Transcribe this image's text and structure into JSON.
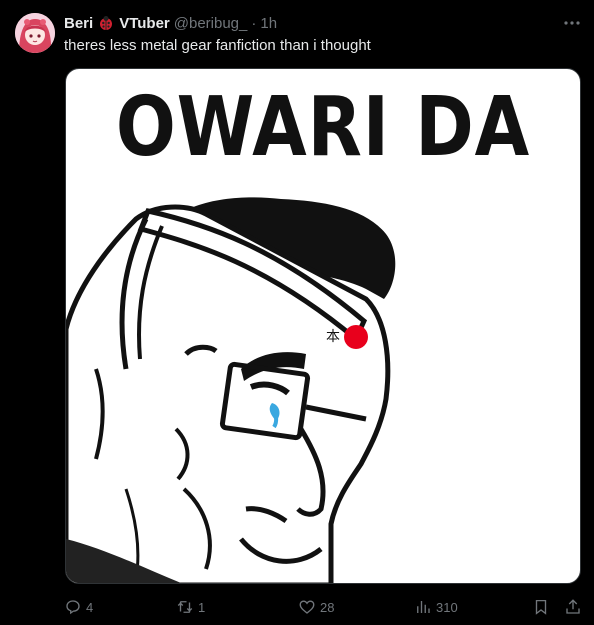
{
  "tweet": {
    "display_name": "Beri",
    "name_suffix": "VTuber",
    "handle": "@beribug_",
    "separator": "·",
    "time": "1h",
    "text": "theres less metal gear fanfiction than i thought",
    "media": {
      "caption": "OWARI DA",
      "headband_kanji": "本"
    },
    "actions": {
      "replies": "4",
      "reposts": "1",
      "likes": "28",
      "views": "310"
    },
    "icons": {
      "more": "more-icon",
      "reply": "reply-icon",
      "repost": "repost-icon",
      "like": "heart-icon",
      "views": "views-icon",
      "bookmark": "bookmark-icon",
      "share": "share-icon",
      "name_emoji": "ladybug-icon"
    },
    "colors": {
      "background": "#000000",
      "text": "#e7e9ea",
      "muted": "#71767b",
      "accent_red": "#e8001c",
      "tear_blue": "#3aa8e0"
    }
  }
}
